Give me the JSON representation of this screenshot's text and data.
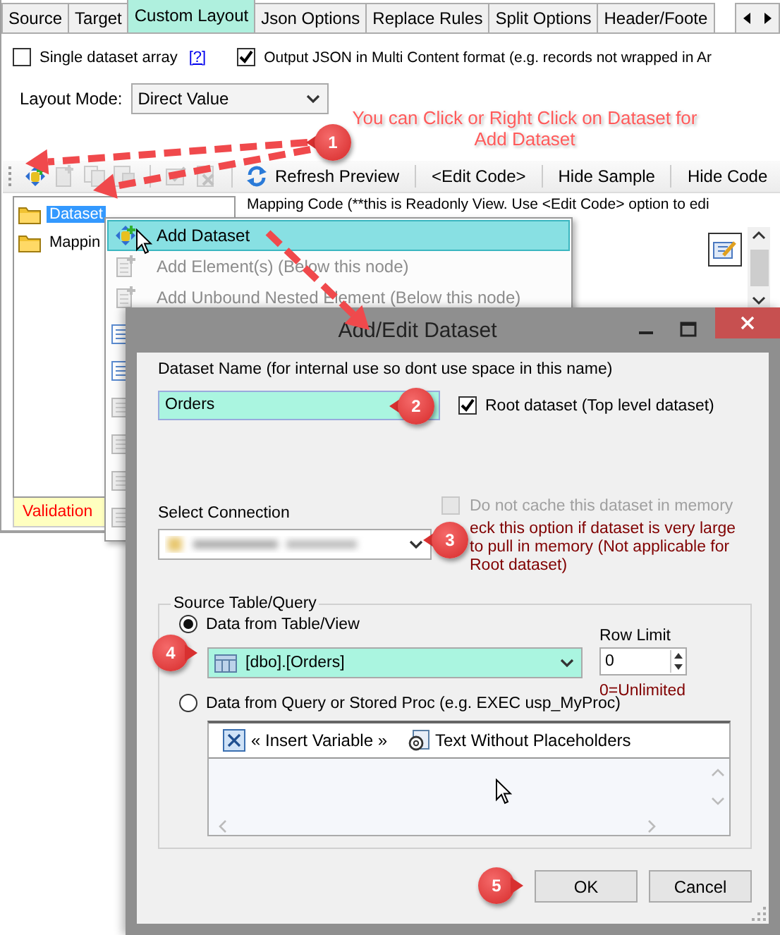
{
  "tabs": [
    {
      "label": "Source",
      "selected": false
    },
    {
      "label": "Target",
      "selected": false
    },
    {
      "label": "Custom Layout",
      "selected": true
    },
    {
      "label": "Json Options",
      "selected": false
    },
    {
      "label": "Replace Rules",
      "selected": false
    },
    {
      "label": "Split Options",
      "selected": false
    },
    {
      "label": "Header/Foote",
      "selected": false
    }
  ],
  "options": [
    {
      "label": "Single dataset array",
      "checked": false,
      "link": "[?]"
    },
    {
      "label": "Output JSON in Multi Content format (e.g. records not wrapped in Ar",
      "checked": true
    }
  ],
  "layout_mode": {
    "label": "Layout Mode:",
    "value": "Direct Value"
  },
  "annotation": "You can Click or Right Click on Dataset for Add Dataset",
  "toolbar": {
    "tools": [
      {
        "kind": "add",
        "disabled": false
      },
      {
        "kind": "element",
        "disabled": true
      },
      {
        "kind": "copy",
        "disabled": true
      },
      {
        "kind": "paste",
        "disabled": true
      },
      {
        "kind": "edit",
        "disabled": true
      },
      {
        "kind": "delete",
        "disabled": true
      }
    ],
    "buttons": [
      "Refresh Preview",
      "<Edit Code>",
      "Hide Sample",
      "Hide Code"
    ]
  },
  "tree": {
    "items": [
      {
        "label": "Dataset",
        "selected": true
      },
      {
        "label": "Mappin",
        "selected": false
      }
    ]
  },
  "mapping_code_label": "Mapping Code (**this is Readonly View. Use <Edit Code> option to edi",
  "validation": "Validation",
  "context_menu": {
    "items": [
      {
        "label": "Add Dataset",
        "selected": true,
        "disabled": false
      },
      {
        "label": "Add Element(s) (Below this node)",
        "selected": false,
        "disabled": true
      },
      {
        "label": "Add Unbound Nested Element (Below this node)",
        "selected": false,
        "disabled": true
      }
    ]
  },
  "dialog": {
    "title": "Add/Edit Dataset",
    "name_label": "Dataset Name (for internal use so dont use space in this name)",
    "name_value": "Orders",
    "root_dataset": {
      "label": "Root dataset (Top level dataset)",
      "checked": true
    },
    "connection_label": "Select Connection",
    "no_cache": {
      "label": "Do not cache this dataset in memory",
      "checked": false,
      "disabled": true
    },
    "cache_hint": "eck this option if dataset is very large to pull in memory (Not applicable for Root dataset)",
    "source": {
      "title": "Source Table/Query",
      "options": [
        {
          "label": "Data from Table/View",
          "selected": true
        },
        {
          "label": "Data from Query or Stored Proc (e.g. EXEC usp_MyProc)",
          "selected": false
        }
      ],
      "table_value": "[dbo].[Orders]",
      "row_limit_label": "Row Limit",
      "row_limit": "0",
      "row_limit_hint": "0=Unlimited",
      "query_tools": [
        "« Insert Variable »",
        "Text Without Placeholders"
      ]
    },
    "buttons": [
      "OK",
      "Cancel"
    ]
  },
  "callouts": [
    "1",
    "2",
    "3",
    "4",
    "5"
  ]
}
